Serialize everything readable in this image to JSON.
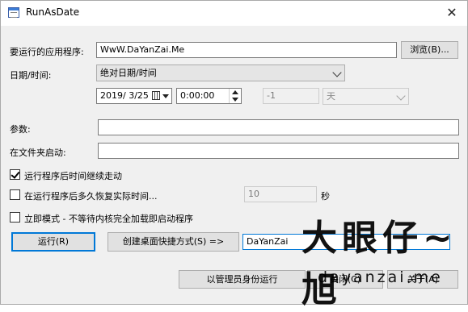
{
  "window": {
    "title": "RunAsDate"
  },
  "app_label": "要运行的应用程序:",
  "app_value": "WwW.DaYanZai.Me",
  "browse_label": "浏览(B)...",
  "datetime_label": "日期/时间:",
  "datetime_mode": "绝对日期/时间",
  "date_value": "2019/  3/25",
  "time_value": "0:00:00",
  "offset_value": "-1",
  "offset_unit": "天",
  "params_label": "参数:",
  "params_value": "",
  "startin_label": "在文件夹启动:",
  "startin_value": "",
  "options": {
    "keep_running_label": "运行程序后时间继续走动",
    "keep_running_checked": true,
    "restore_label": "在运行程序后多久恢复实际时间...",
    "restore_checked": false,
    "restore_value": "10",
    "restore_unit": "秒",
    "immediate_label": "立即模式 - 不等待内核完全加载即启动程序",
    "immediate_checked": false
  },
  "run_label": "运行(R)",
  "shortcut_label": "创建桌面快捷方式(S) =>",
  "shortcut_name": "DaYanZai",
  "admin_label": "以管理员身份运行",
  "close_label": "关闭(C)",
  "about_label": "关于(A)",
  "watermark": {
    "cn": "大眼仔~旭",
    "en": "dayanzai.me"
  },
  "colors": {
    "accent": "#0078d7",
    "window_bg": "#f0f0f0"
  }
}
